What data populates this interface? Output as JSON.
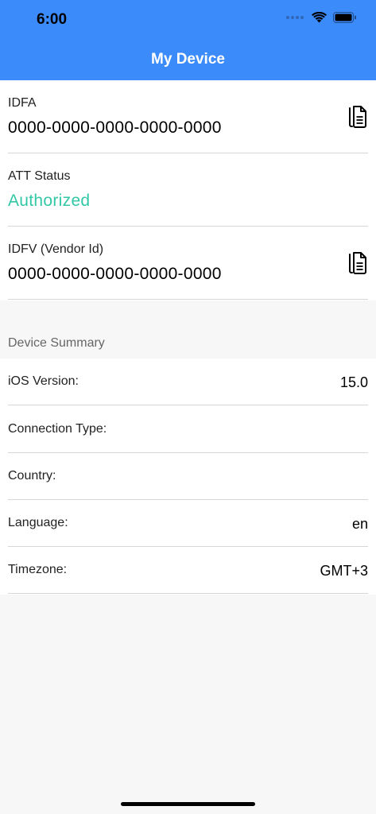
{
  "status_bar": {
    "time": "6:00"
  },
  "nav": {
    "title": "My Device"
  },
  "identifiers": [
    {
      "label": "IDFA",
      "value": "0000-0000-0000-0000-0000",
      "copy_icon": "copy-icon"
    },
    {
      "label": "ATT Status",
      "value": "Authorized"
    },
    {
      "label": "IDFV (Vendor Id)",
      "value": "0000-0000-0000-0000-0000",
      "copy_icon": "copy-icon"
    }
  ],
  "summary": {
    "header": "Device Summary",
    "rows": [
      {
        "label": "iOS Version:",
        "value": "15.0"
      },
      {
        "label": "Connection Type:",
        "value": ""
      },
      {
        "label": "Country:",
        "value": ""
      },
      {
        "label": "Language:",
        "value": "en"
      },
      {
        "label": "Timezone:",
        "value": "GMT+3"
      }
    ]
  },
  "colors": {
    "header": "#3c8bfb",
    "authorized": "#32c7a6",
    "background": "#f7f7f7"
  }
}
